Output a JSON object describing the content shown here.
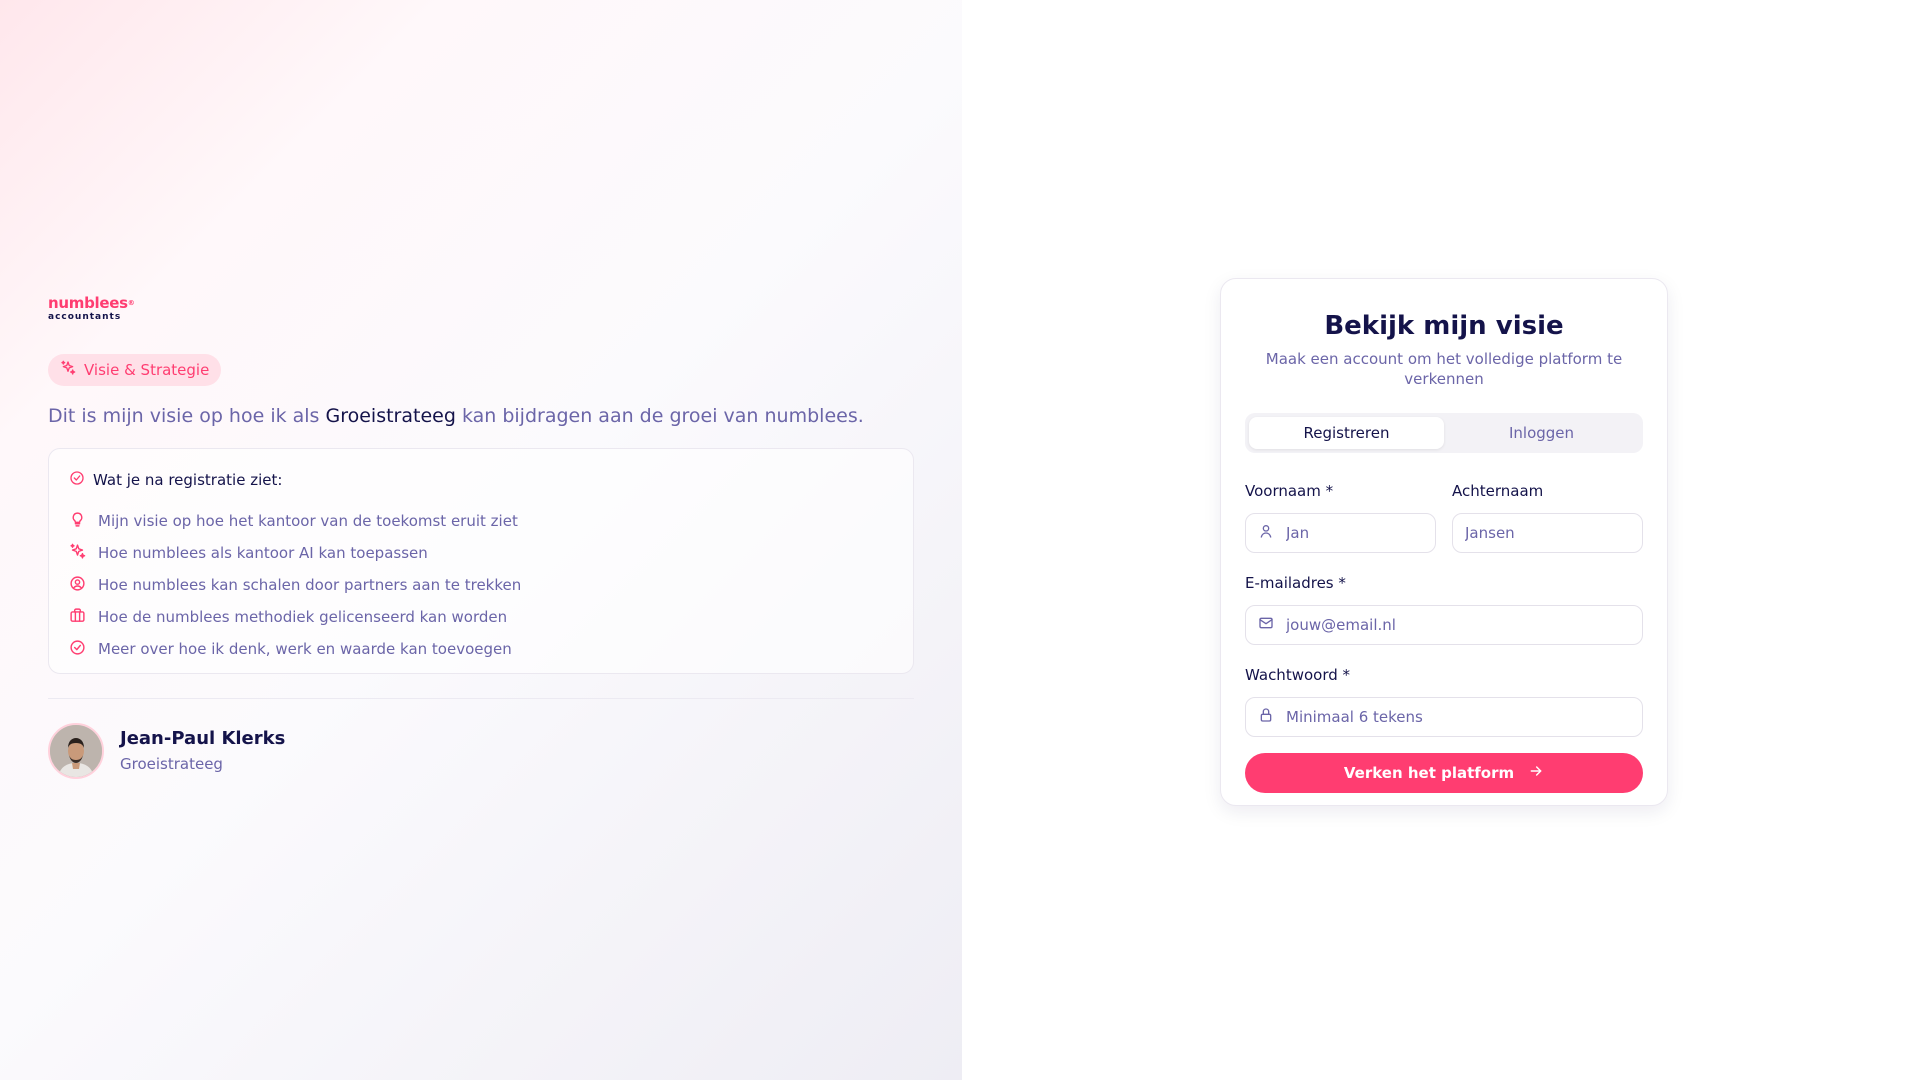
{
  "brand": {
    "name_top": "numblees",
    "name_bottom": "accountants",
    "mark": "®"
  },
  "colors": {
    "accent": "#ff3d71",
    "text_dark": "#14134a",
    "text_muted": "#6b65a8"
  },
  "badge": {
    "label": "Visie & Strategie",
    "icon": "sparkles-icon"
  },
  "intro": {
    "before": "Dit is mijn visie op hoe ik als ",
    "highlight": "Groeistrateeg",
    "after": " kan bijdragen aan de groei van numblees."
  },
  "features": {
    "title": "Wat je na registratie ziet:",
    "items": [
      {
        "icon": "lightbulb-icon",
        "label": "Mijn visie op hoe het kantoor van de toekomst eruit ziet"
      },
      {
        "icon": "sparkles-icon",
        "label": "Hoe numblees als kantoor AI kan toepassen"
      },
      {
        "icon": "user-circle-icon",
        "label": "Hoe numblees kan schalen door partners aan te trekken"
      },
      {
        "icon": "briefcase-icon",
        "label": "Hoe de numblees methodiek gelicenseerd kan worden"
      },
      {
        "icon": "check-circle-icon",
        "label": "Meer over hoe ik denk, werk en waarde kan toevoegen"
      }
    ]
  },
  "profile": {
    "name": "Jean-Paul Klerks",
    "role": "Groeistrateeg"
  },
  "form": {
    "title": "Bekijk mijn visie",
    "subtitle": "Maak een account om het volledige platform te verkennen",
    "tabs": [
      {
        "label": "Registreren",
        "active": true
      },
      {
        "label": "Inloggen",
        "active": false
      }
    ],
    "first_name": {
      "label": "Voornaam *",
      "placeholder": "Jan",
      "value": ""
    },
    "last_name": {
      "label": "Achternaam",
      "placeholder": "Jansen",
      "value": ""
    },
    "email": {
      "label": "E-mailadres *",
      "placeholder": "jouw@email.nl",
      "value": ""
    },
    "password": {
      "label": "Wachtwoord *",
      "placeholder": "Minimaal 6 tekens",
      "value": ""
    },
    "submit_label": "Verken het platform"
  }
}
